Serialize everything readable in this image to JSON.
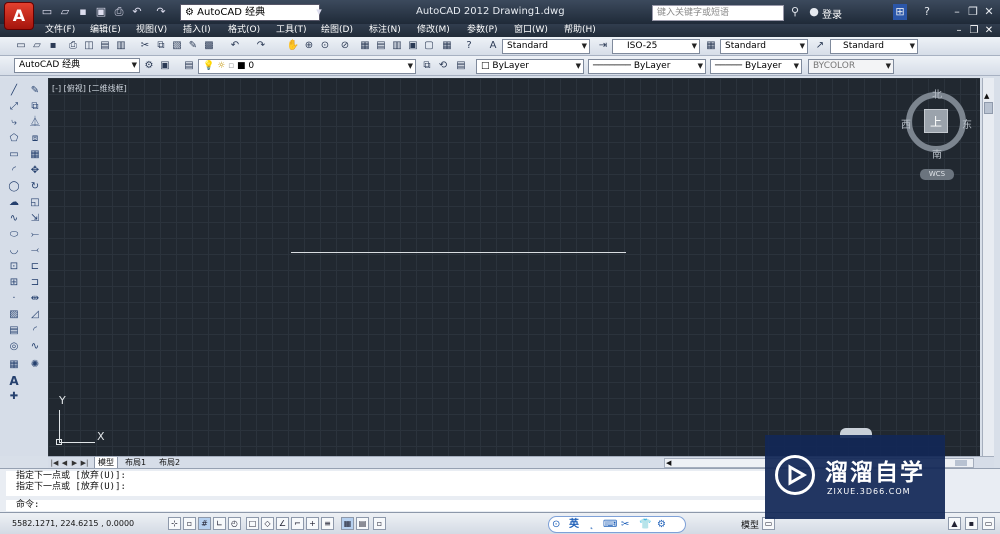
{
  "titlebar": {
    "logo_letter": "A",
    "workspace": "AutoCAD 经典",
    "title": "AutoCAD 2012    Drawing1.dwg",
    "search_placeholder": "键入关键字或短语",
    "login": "登录",
    "qa_icons": [
      "new-file-icon",
      "open-icon",
      "save-icon",
      "save-as-icon",
      "print-icon",
      "undo-icon",
      "redo-icon"
    ]
  },
  "menu": {
    "items": [
      "文件(F)",
      "编辑(E)",
      "视图(V)",
      "插入(I)",
      "格式(O)",
      "工具(T)",
      "绘图(D)",
      "标注(N)",
      "修改(M)",
      "参数(P)",
      "窗口(W)",
      "帮助(H)"
    ]
  },
  "styles": {
    "text_style": "Standard",
    "dim_style": "ISO-25",
    "table_style": "Standard",
    "mleader_style": "Standard"
  },
  "layers": {
    "workspace": "AutoCAD 经典",
    "current_layer": "0",
    "color": "ByLayer",
    "linetype": "ByLayer",
    "lineweight": "ByLayer",
    "plotstyle": "BYCOLOR"
  },
  "viewport": {
    "label": "[-] [俯视] [二维线框]",
    "viewcube": {
      "top": "上",
      "north": "北",
      "south": "南",
      "west": "西",
      "east": "东",
      "wcs": "WCS"
    },
    "ucs": {
      "x": "X",
      "y": "Y"
    }
  },
  "tabs": [
    "模型",
    "布局1",
    "布局2"
  ],
  "command": {
    "history": [
      "指定下一点或 [放弃(U)]:",
      "指定下一点或 [放弃(U)]:"
    ],
    "prompt": "命令:"
  },
  "status": {
    "coords": "5582.1271,  224.6215  ,  0.0000",
    "model": "模型",
    "ime": "英"
  },
  "watermark": {
    "title": "溜溜自学",
    "url": "ZIXUE.3D66.COM"
  },
  "colors": {
    "canvas": "#212830",
    "grid": "#2b333c",
    "titlebar": "#2a3647",
    "logo_red": "#c8281a"
  }
}
